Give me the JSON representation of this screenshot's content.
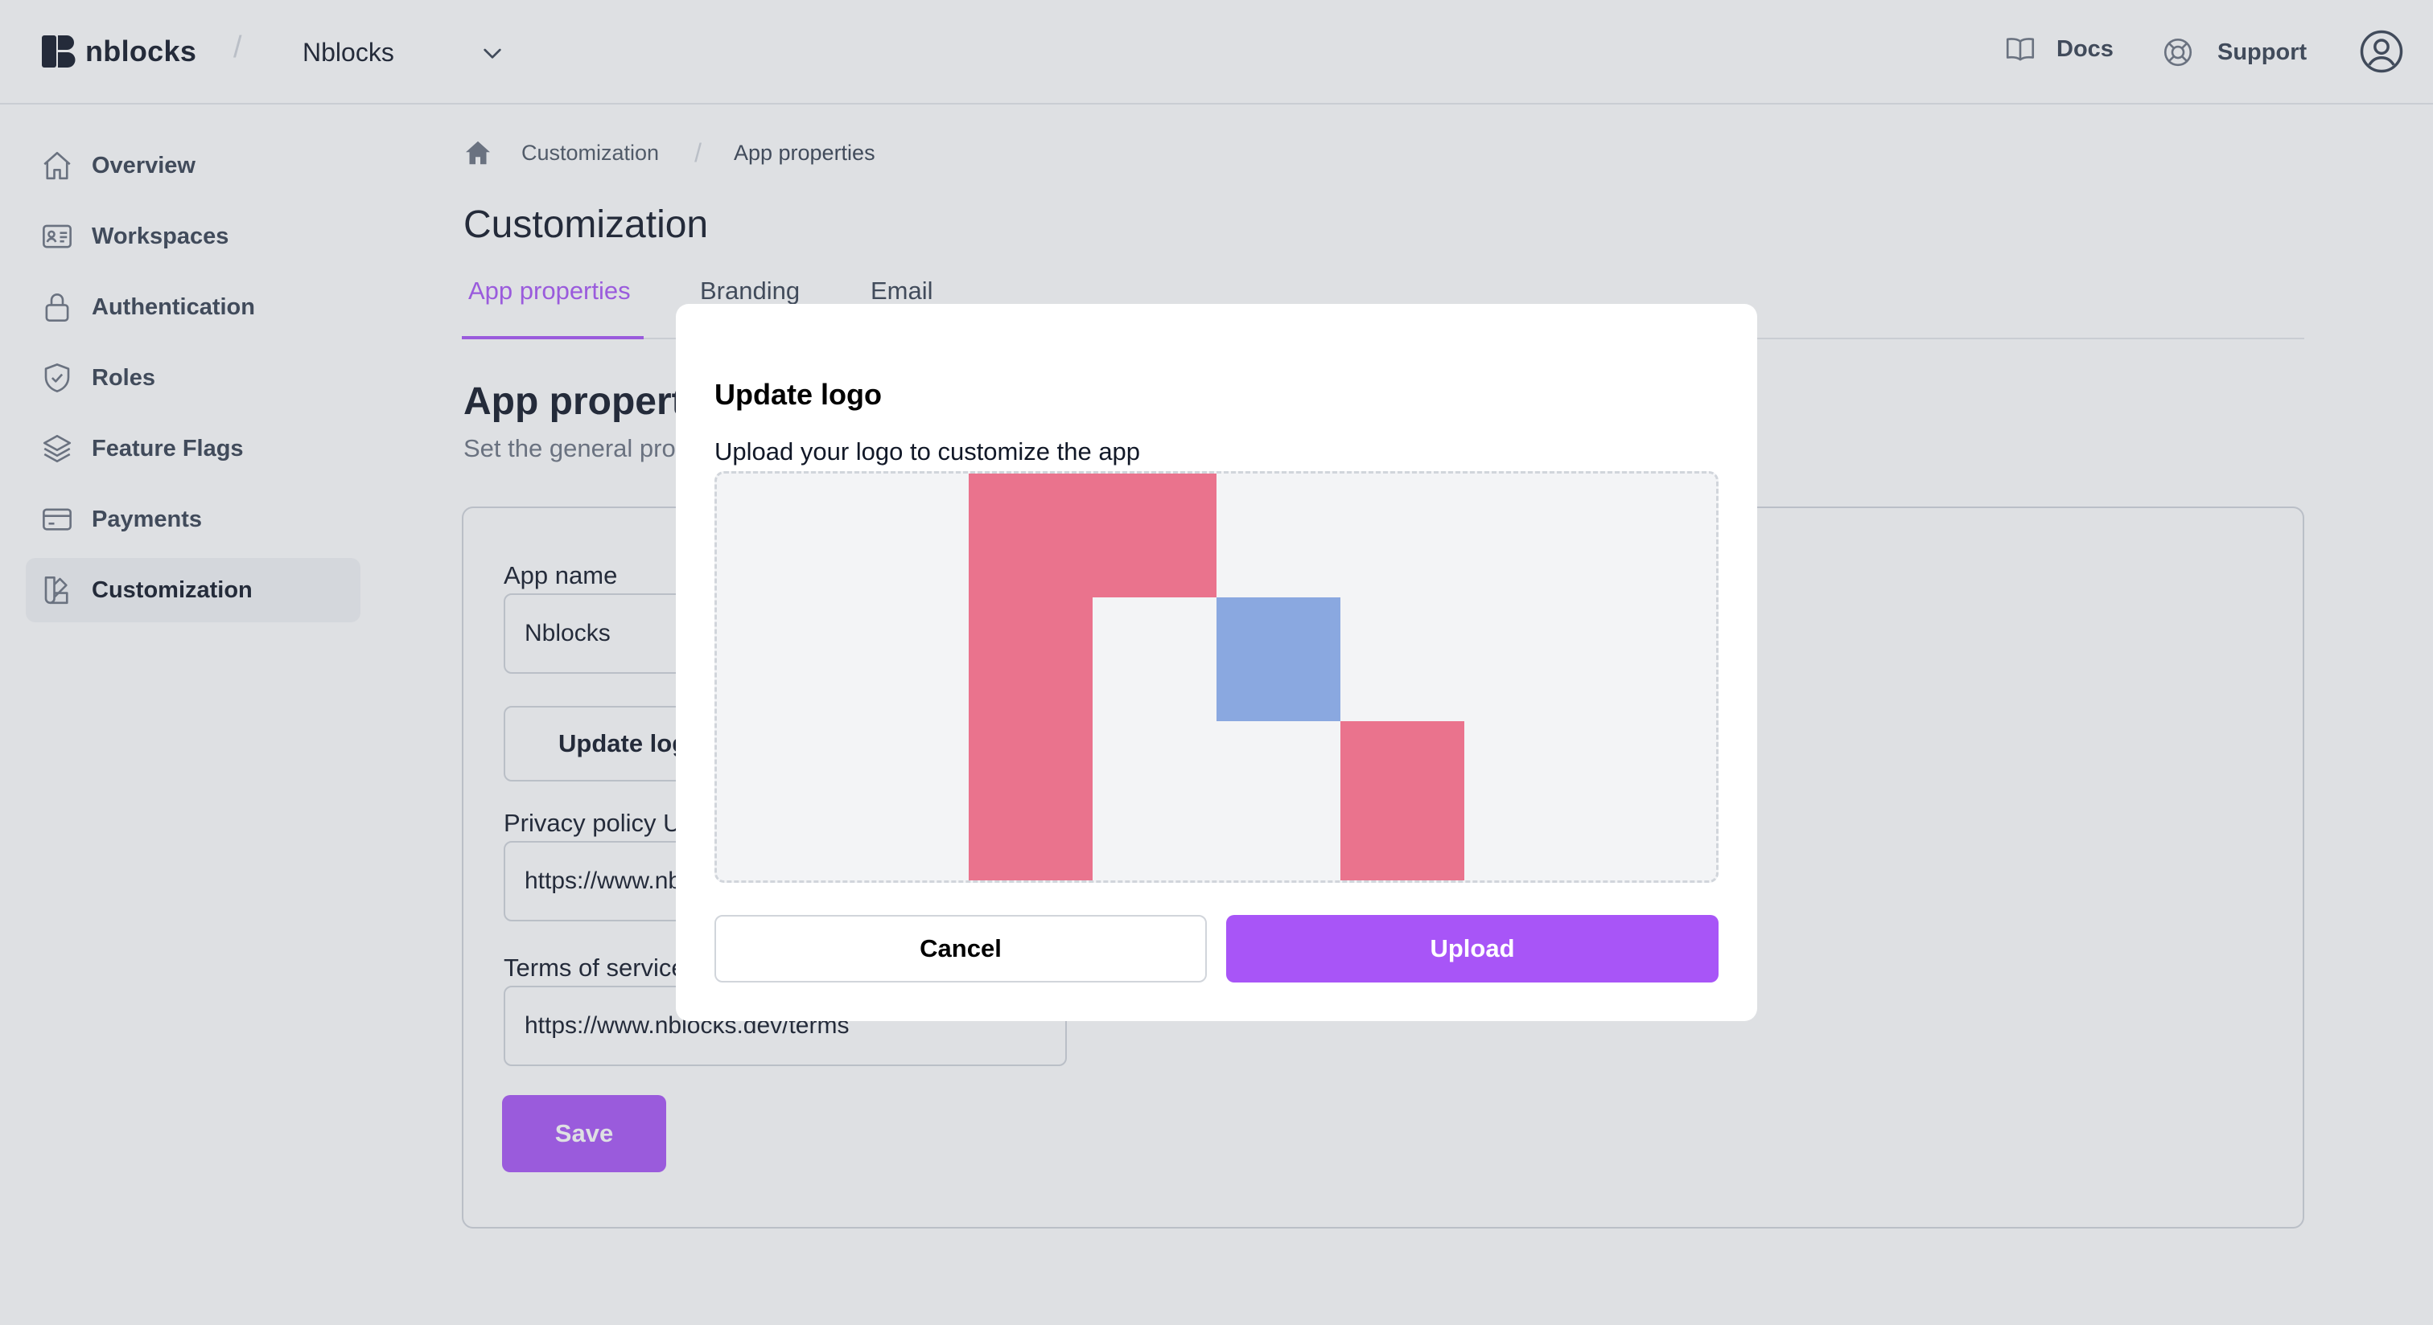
{
  "header": {
    "brand_name": "nblocks",
    "separator": "/",
    "workspace": "Nblocks",
    "docs_label": "Docs",
    "support_label": "Support"
  },
  "sidebar": {
    "items": [
      {
        "label": "Overview",
        "icon": "home-icon",
        "active": false
      },
      {
        "label": "Workspaces",
        "icon": "id-card-icon",
        "active": false
      },
      {
        "label": "Authentication",
        "icon": "lock-icon",
        "active": false
      },
      {
        "label": "Roles",
        "icon": "shield-check-icon",
        "active": false
      },
      {
        "label": "Feature Flags",
        "icon": "layers-icon",
        "active": false
      },
      {
        "label": "Payments",
        "icon": "credit-card-icon",
        "active": false
      },
      {
        "label": "Customization",
        "icon": "swatch-icon",
        "active": true
      }
    ]
  },
  "breadcrumb": {
    "items": [
      "Customization",
      "App properties"
    ],
    "separator": "/"
  },
  "page": {
    "title": "Customization",
    "tabs": [
      {
        "label": "App properties",
        "active": true
      },
      {
        "label": "Branding",
        "active": false
      },
      {
        "label": "Email",
        "active": false
      }
    ],
    "section_title": "App properties",
    "section_subtitle": "Set the general properties for your app"
  },
  "form": {
    "app_name_label": "App name",
    "app_name_value": "Nblocks",
    "update_logo_label": "Update logo",
    "privacy_label": "Privacy policy URL",
    "privacy_value": "https://www.nblocks.dev/privacy",
    "terms_label": "Terms of service URL",
    "terms_value": "https://www.nblocks.dev/terms",
    "save_label": "Save"
  },
  "modal": {
    "title": "Update logo",
    "subtitle": "Upload your logo to customize the app",
    "cancel_label": "Cancel",
    "upload_label": "Upload"
  },
  "colors": {
    "accent": "#a855f7",
    "logo_pink": "#ea738d",
    "logo_blue": "#8aa8e0",
    "dropzone_bg": "#f3f4f6"
  }
}
